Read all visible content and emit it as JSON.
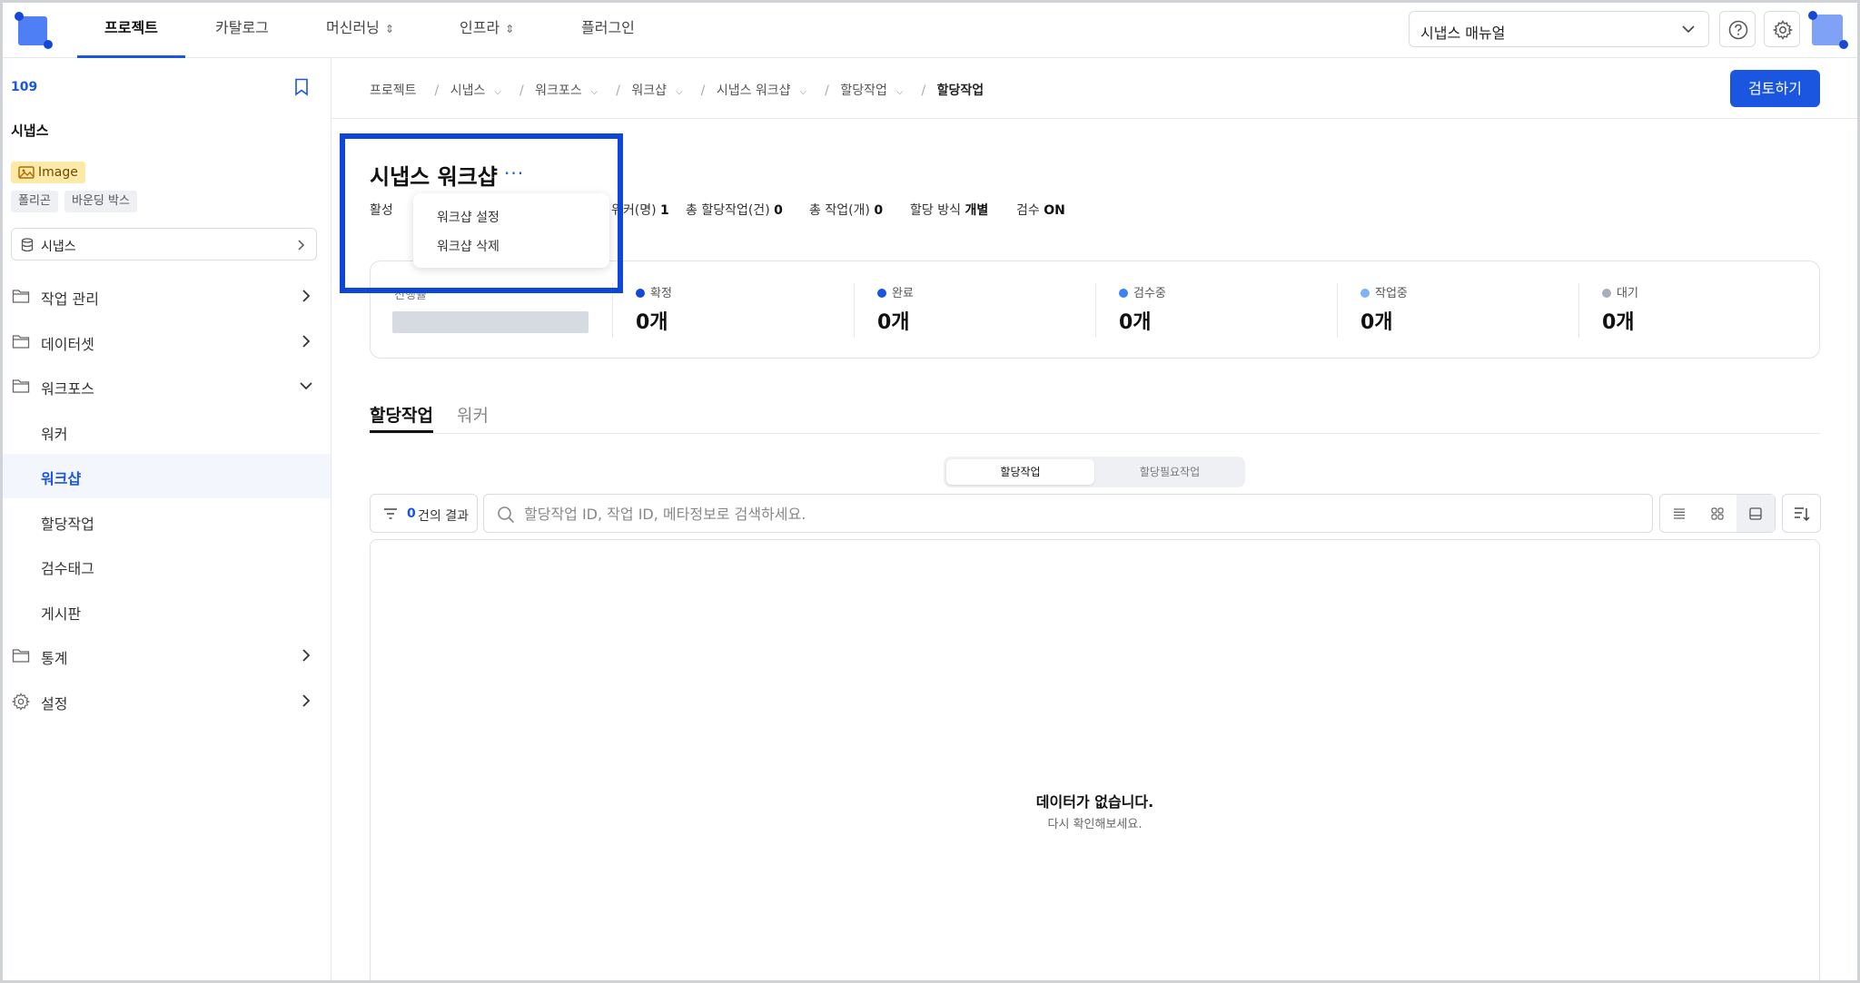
{
  "topnav": {
    "tabs": [
      {
        "label": "프로젝트"
      },
      {
        "label": "카탈로그"
      },
      {
        "label": "머신러닝"
      },
      {
        "label": "인프라"
      },
      {
        "label": "플러그인"
      }
    ],
    "manual_select": "시냅스 매뉴얼"
  },
  "sidebar": {
    "project_id": "109",
    "project_name": "시냅스",
    "badge": "Image",
    "tags": [
      "폴리곤",
      "바운딩 박스"
    ],
    "dataset": "시냅스",
    "menu": [
      {
        "label": "작업 관리"
      },
      {
        "label": "데이터셋"
      },
      {
        "label": "워크포스"
      }
    ],
    "submenu": [
      {
        "label": "워커"
      },
      {
        "label": "워크샵"
      },
      {
        "label": "할당작업"
      },
      {
        "label": "검수태그"
      },
      {
        "label": "게시판"
      }
    ],
    "bottom_menu": [
      {
        "label": "통계"
      },
      {
        "label": "설정"
      }
    ]
  },
  "breadcrumb": {
    "items": [
      "프로젝트",
      "시냅스",
      "워크포스",
      "워크샵",
      "시냅스 워크샵",
      "할당작업"
    ],
    "current": "할당작업"
  },
  "review_button": "검토하기",
  "workshop": {
    "title": "시냅스 워크샵",
    "more": "···",
    "status_label": "활성",
    "workers_label": "워커(명)",
    "workers_value": "1",
    "total_assign_label": "총 할당작업(건)",
    "total_assign_value": "0",
    "total_tasks_label": "총 작업(개)",
    "total_tasks_value": "0",
    "assign_method_label": "할당 방식",
    "assign_method_value": "개별",
    "review_label": "검수",
    "review_value": "ON"
  },
  "dropdown": {
    "options": [
      "워크샵 설정",
      "워크샵 삭제"
    ]
  },
  "progress": {
    "label": "진행률",
    "stats": [
      {
        "label": "확정",
        "value": "0개",
        "color": "#1747d6"
      },
      {
        "label": "완료",
        "value": "0개",
        "color": "#1a56e0"
      },
      {
        "label": "검수중",
        "value": "0개",
        "color": "#3b82f6"
      },
      {
        "label": "작업중",
        "value": "0개",
        "color": "#7cb5f5"
      },
      {
        "label": "대기",
        "value": "0개",
        "color": "#a7afba"
      }
    ]
  },
  "tabs": [
    {
      "label": "할당작업"
    },
    {
      "label": "워커"
    }
  ],
  "segment": {
    "options": [
      "할당작업",
      "할당필요작업"
    ]
  },
  "filter": {
    "count": "0",
    "suffix": "건의 결과"
  },
  "search": {
    "placeholder": "할당작업 ID, 작업 ID, 메타정보로 검색하세요."
  },
  "empty": {
    "title": "데이터가 없습니다.",
    "subtitle": "다시 확인해보세요."
  }
}
